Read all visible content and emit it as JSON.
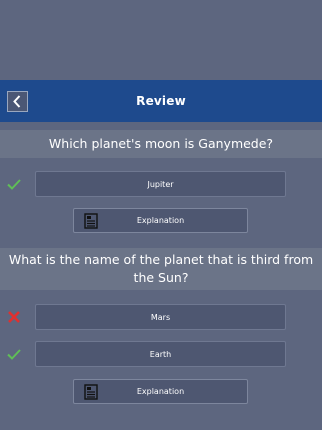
{
  "header": {
    "title": "Review",
    "back_icon": "chevron-left-icon"
  },
  "questions": [
    {
      "text": "Which planet's moon is Ganymede?",
      "answers": [
        {
          "label": "Jupiter",
          "status": "correct"
        }
      ],
      "explanation_label": "Explanation"
    },
    {
      "text": "What is the name of the planet that is third from the Sun?",
      "answers": [
        {
          "label": "Mars",
          "status": "wrong"
        },
        {
          "label": "Earth",
          "status": "correct"
        }
      ],
      "explanation_label": "Explanation"
    }
  ],
  "colors": {
    "background": "#5d667f",
    "header": "#1e4a8d",
    "correct": "#5fbf57",
    "wrong": "#e0302f"
  }
}
